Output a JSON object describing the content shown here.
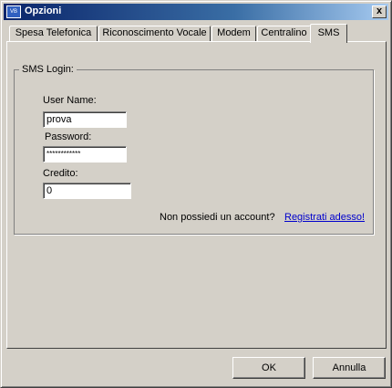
{
  "window": {
    "title": "Opzioni",
    "icon": "app-icon",
    "close_label": "x"
  },
  "tabs": [
    {
      "label": "Spesa Telefonica",
      "active": false
    },
    {
      "label": "Riconoscimento Vocale",
      "active": false
    },
    {
      "label": "Modem",
      "active": false
    },
    {
      "label": "Centralino",
      "active": false
    },
    {
      "label": "SMS",
      "active": true
    }
  ],
  "sms_login": {
    "group_title": "SMS Login:",
    "username_label": "User Name:",
    "username_value": "prova",
    "password_label": "Password:",
    "password_value": "************",
    "credit_label": "Credito:",
    "credit_value": "0",
    "no_account_text": "Non possiedi un account?",
    "register_link": "Registrati adesso!"
  },
  "buttons": {
    "ok": "OK",
    "cancel": "Annulla"
  },
  "colors": {
    "titlebar_start": "#0a246a",
    "titlebar_end": "#a6caf0",
    "link": "#0000cc",
    "face": "#d4d0c8"
  }
}
